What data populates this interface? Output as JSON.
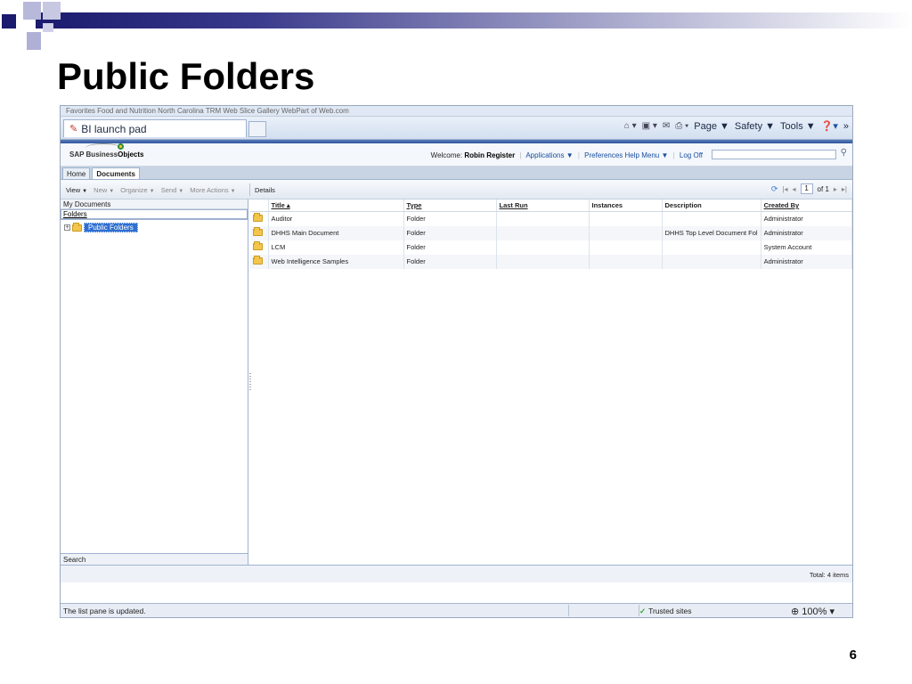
{
  "slide": {
    "title": "Public Folders",
    "page_number": "6"
  },
  "browser": {
    "favorites_bar": "Favorites   Food and Nutrition   North Carolina TRM   Web Slice Gallery   WebPart of Web.com",
    "tab_title": "BI launch pad",
    "command_bar": {
      "page": "Page ▼",
      "safety": "Safety ▼",
      "tools": "Tools ▼",
      "help": "❓▾",
      "more": "»"
    },
    "status_message": "The list pane is updated.",
    "zone": "Trusted sites",
    "zoom": "100%"
  },
  "app": {
    "logo_prefix": "SAP Business",
    "logo_suffix": "Objects",
    "welcome_label": "Welcome:",
    "user": "Robin Register",
    "menu": {
      "applications": "Applications ▼",
      "preferences": "Preferences",
      "help": "Help Menu ▼",
      "logoff": "Log Off"
    },
    "nav_tabs": [
      "Home",
      "Documents"
    ],
    "toolbar": {
      "view": "View",
      "new": "New",
      "organize": "Organize",
      "send": "Send",
      "more": "More Actions",
      "details": "Details"
    },
    "pager": {
      "current": "1",
      "of": "of 1"
    },
    "left_pane": {
      "header": "My Documents",
      "folders_label": "Folders",
      "tree_root": "Public Folders",
      "search_label": "Search"
    },
    "columns": [
      "Title ▴",
      "Type",
      "Last Run",
      "Instances",
      "Description",
      "Created By"
    ],
    "rows": [
      {
        "title": "Auditor",
        "type": "Folder",
        "last_run": "",
        "instances": "",
        "description": "",
        "created_by": "Administrator"
      },
      {
        "title": "DHHS Main Document",
        "type": "Folder",
        "last_run": "",
        "instances": "",
        "description": "DHHS Top Level Document Fol",
        "created_by": "Administrator"
      },
      {
        "title": "LCM",
        "type": "Folder",
        "last_run": "",
        "instances": "",
        "description": "",
        "created_by": "System Account"
      },
      {
        "title": "Web Intelligence Samples",
        "type": "Folder",
        "last_run": "",
        "instances": "",
        "description": "",
        "created_by": "Administrator"
      }
    ],
    "total": "Total: 4 items"
  }
}
